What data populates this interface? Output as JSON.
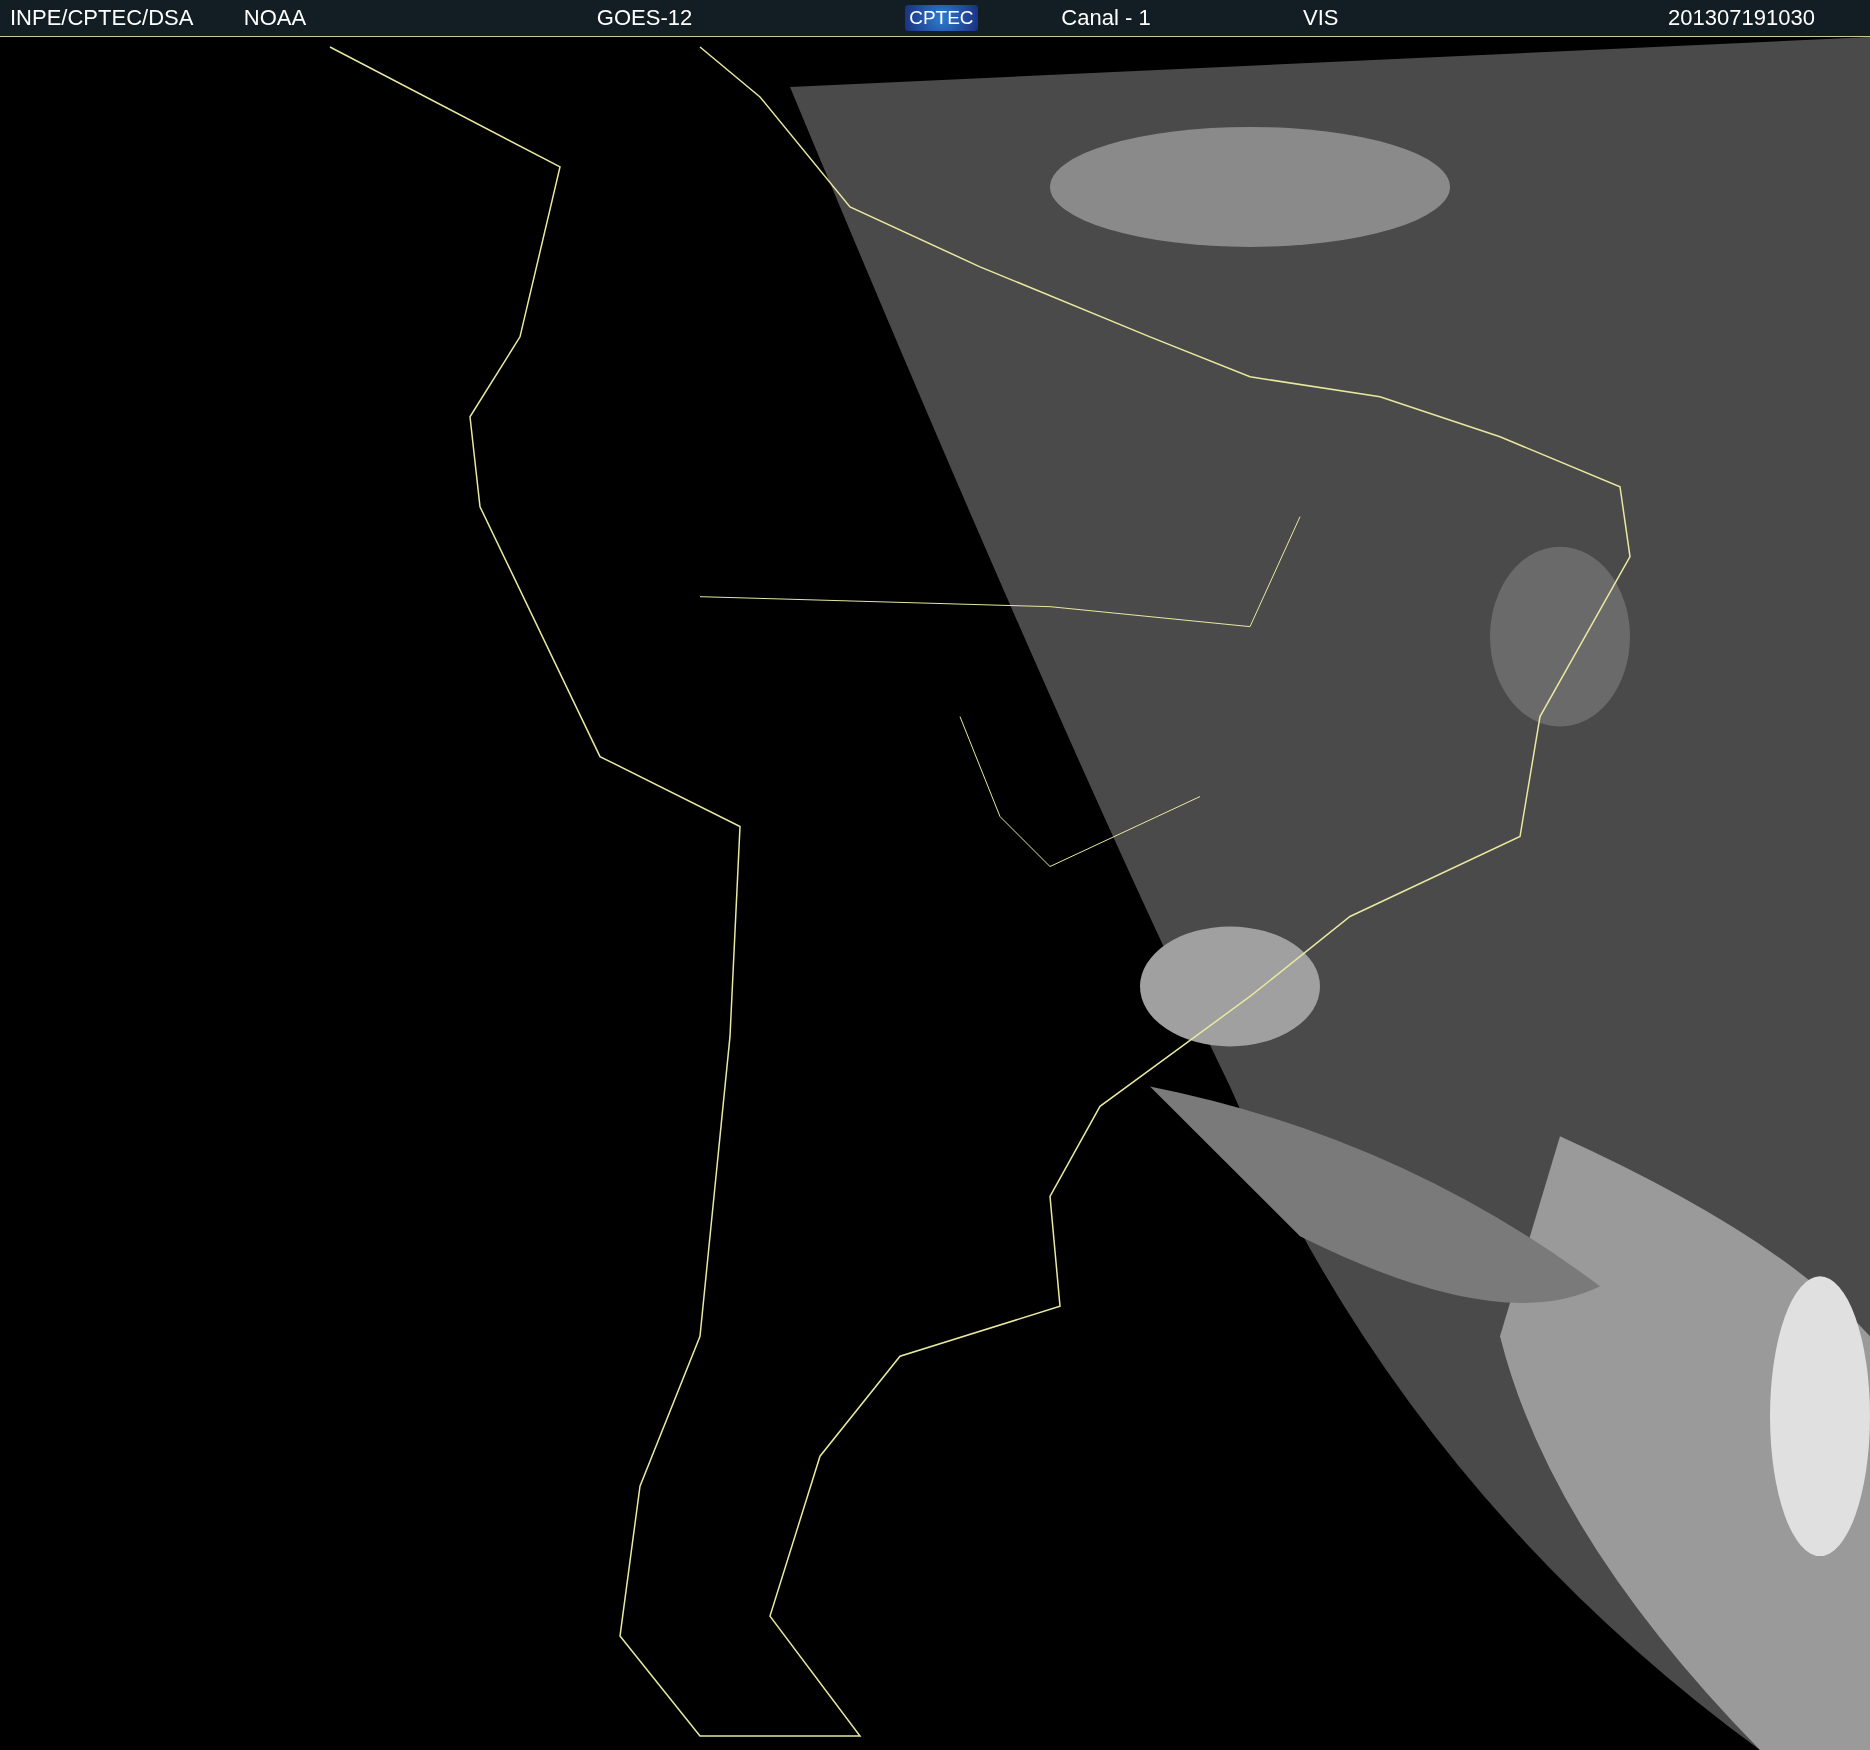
{
  "header": {
    "items": [
      {
        "kind": "text",
        "text": "INPE/CPTEC/DSA"
      },
      {
        "kind": "text",
        "text": "NOAA"
      },
      {
        "kind": "text",
        "text": "GOES-12"
      },
      {
        "kind": "logo",
        "text": "CPTEC"
      },
      {
        "kind": "text",
        "text": "Canal - 1"
      },
      {
        "kind": "text",
        "text": "VIS"
      },
      {
        "kind": "text",
        "text": "201307191030"
      }
    ]
  }
}
